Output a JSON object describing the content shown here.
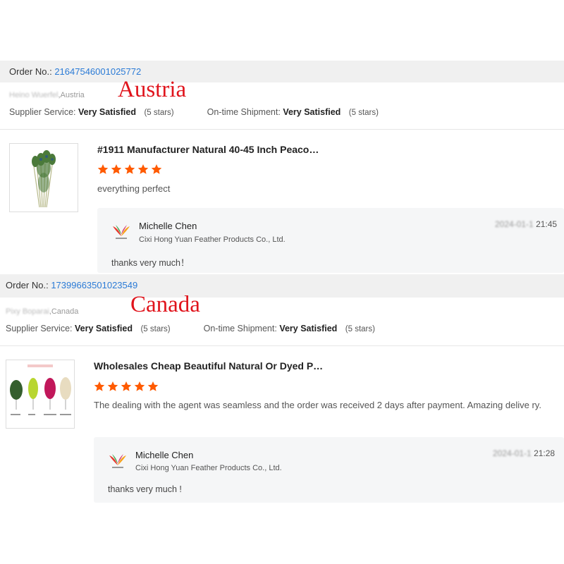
{
  "colors": {
    "accent_link": "#2b7bd6",
    "star": "#ff5a00",
    "country_label": "#e0141c",
    "order_bar_bg": "#f0f0f0",
    "reply_bg": "#f5f6f7"
  },
  "reviews": [
    {
      "order_label": "Order No.:",
      "order_number": "21647546001025772",
      "buyer_name": "Heino Wuerfel",
      "buyer_country": ",Austria",
      "country_overlay": "Austria",
      "supplier_service_label": "Supplier Service:",
      "supplier_service_value": "Very Satisfied",
      "supplier_service_stars": "(5 stars)",
      "shipment_label": "On-time Shipment:",
      "shipment_value": "Very Satisfied",
      "shipment_stars": "(5 stars)",
      "product_title": "#1911 Manufacturer Natural 40-45 Inch Peaco…",
      "product_icon": "peacock-feather-bundle-image",
      "rating": 5,
      "review_text": "everything perfect",
      "reply": {
        "name": "Michelle Chen",
        "company": "Cixi Hong Yuan Feather Products Co., Ltd.",
        "date_masked": "2024-01-1",
        "time": "21:45",
        "message": "thanks very much！"
      }
    },
    {
      "order_label": "Order No.:",
      "order_number": "17399663501023549",
      "buyer_name": "Pixy Boparai",
      "buyer_country": ",Canada",
      "country_overlay": "Canada",
      "supplier_service_label": "Supplier Service:",
      "supplier_service_value": "Very Satisfied",
      "supplier_service_stars": "(5 stars)",
      "shipment_label": "On-time Shipment:",
      "shipment_value": "Very Satisfied",
      "shipment_stars": "(5 stars)",
      "product_title": "Wholesales Cheap Beautiful Natural Or Dyed P…",
      "product_icon": "dyed-feathers-image",
      "rating": 5,
      "review_text": "The dealing with the agent was seamless and the order was received 2 days after payment. Amazing delive ry.",
      "reply": {
        "name": "Michelle Chen",
        "company": "Cixi Hong Yuan Feather Products Co., Ltd.",
        "date_masked": "2024-01-1",
        "time": "21:28",
        "message": "thanks very much !"
      }
    }
  ]
}
